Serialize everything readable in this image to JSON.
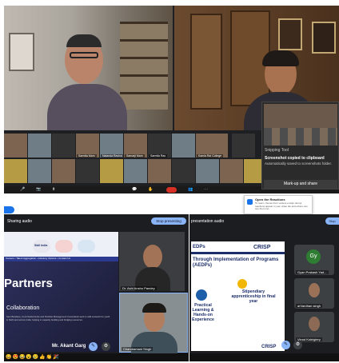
{
  "top_meeting": {
    "speaker_left_name": "",
    "speaker_right_name": "",
    "thumbnails": [
      {
        "name": ""
      },
      {
        "name": ""
      },
      {
        "name": ""
      },
      {
        "name": "Sarmila Mam"
      },
      {
        "name": "Nalanda Raviva"
      },
      {
        "name": "Samarji Mam"
      },
      {
        "name": "Sarmila Rao"
      },
      {
        "name": ""
      },
      {
        "name": "Kamla Rai College"
      },
      {
        "name": ""
      },
      {
        "name": ""
      },
      {
        "name": ""
      },
      {
        "name": ""
      },
      {
        "name": ""
      },
      {
        "name": ""
      },
      {
        "name": ""
      },
      {
        "name": ""
      },
      {
        "name": ""
      },
      {
        "name": ""
      },
      {
        "name": ""
      },
      {
        "name": ""
      }
    ],
    "notification": {
      "header": "Snipping Tool",
      "title": "Screenshot copied to clipboard",
      "subtitle": "Automatically saved to screenshots folder.",
      "button": "Mark-up and share"
    }
  },
  "left_share": {
    "shared_audio": "Sharing audio",
    "stop_button": "Stop presenting",
    "slide": {
      "logo1": "Skill India",
      "nav_items": "Careers • Talent Aggregation • Advisory Options • Contact Us",
      "headline": "Partners",
      "section": "Collaboration",
      "paragraph": "Sem Bandana, Cecil Global Hubs and Portfolio Management Consultants work to skill outreach for youth in Delhi and across India; helping in capacity building and bridging resources.",
      "presenter_name": "Mr. Akant Garg"
    },
    "tile1_name": "Dr. Ashi Anshu Pandey",
    "tile2_name": "Chandramani Singh",
    "emojis": "😀😍😂😮😢👍👏🎉"
  },
  "right_share": {
    "shared_audio": "presentation audio",
    "stop_button": "Stop",
    "popup": {
      "title": "Open the Reactions",
      "body": "To react, choose from various emojis. Emoji reactions appear in your video tile and others can see them too."
    },
    "slide": {
      "heading": "EDPs",
      "brand_top": "CRISP",
      "title": "Through Implementation of Programs (AEDPs)",
      "item1": "Stipendiary apprenticeship in final year",
      "item2": "Practical Learning & Hands-on Experience",
      "brand_bottom": "CRISP"
    },
    "participants": [
      {
        "initials": "Gy",
        "name": "Gyan Prakash Yad..."
      },
      {
        "name": "arVardhan singh"
      },
      {
        "name": "Vinod Koinigiery"
      }
    ]
  }
}
